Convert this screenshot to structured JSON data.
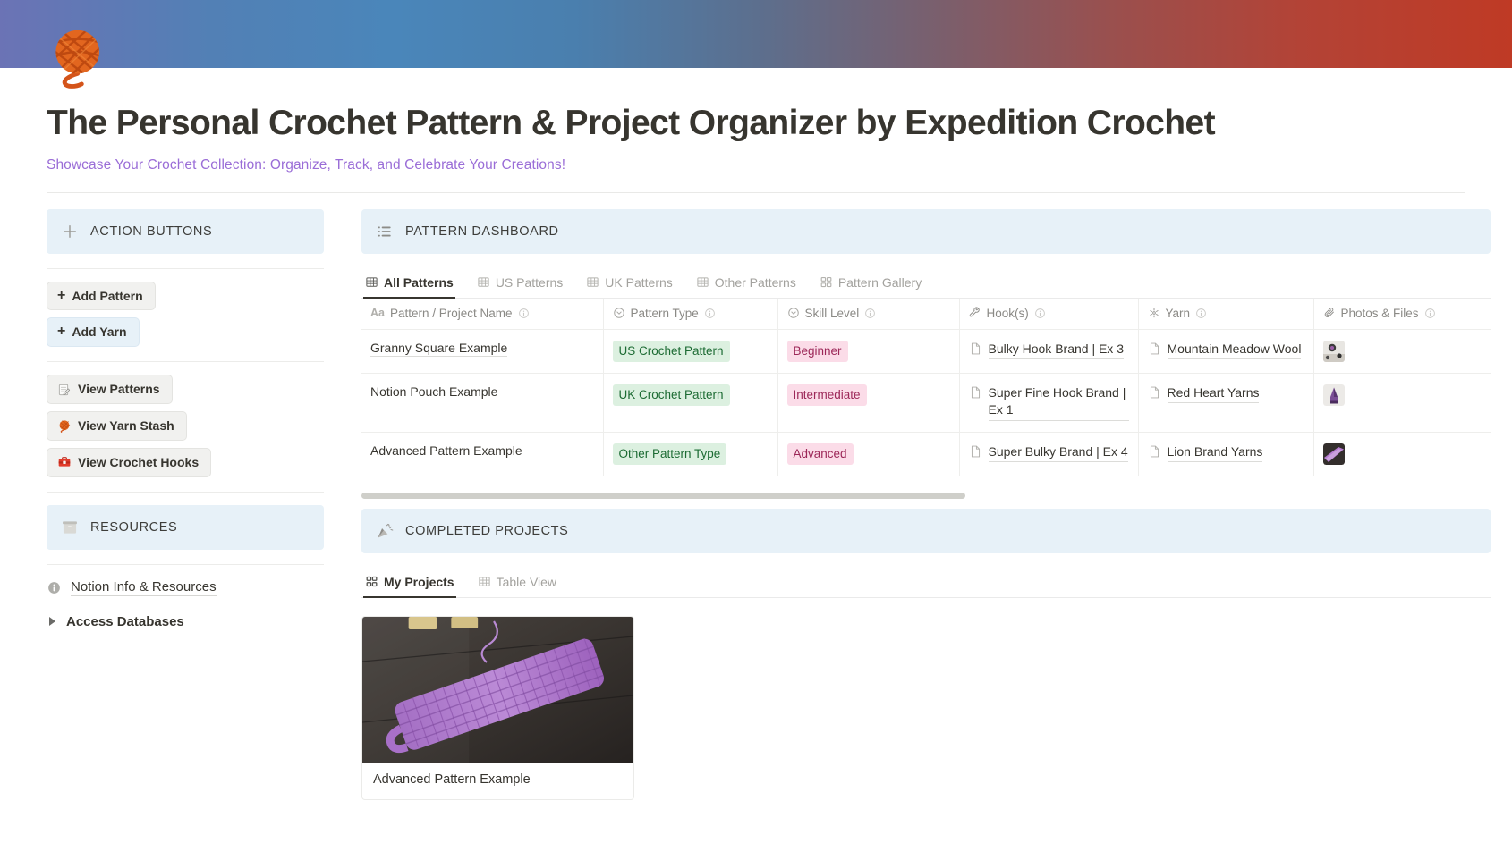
{
  "banner": {
    "icon": "yarn-ball-emoji"
  },
  "header": {
    "title": "The Personal Crochet Pattern & Project Organizer by Expedition Crochet",
    "subtitle": "Showcase Your Crochet Collection: Organize, Track, and Celebrate Your Creations!",
    "subtitle_color": "#9a6dd7"
  },
  "sidebar": {
    "action_section": {
      "label": "ACTION BUTTONS",
      "icon": "plus-icon",
      "bg": "#e7f1f8"
    },
    "buttons": [
      {
        "label": "Add Pattern",
        "icon": "plus-icon",
        "style": "grey"
      },
      {
        "label": "Add Yarn",
        "icon": "plus-icon",
        "style": "blue"
      },
      {
        "label": "View Patterns",
        "icon": "memo-icon",
        "style": "grey"
      },
      {
        "label": "View Yarn Stash",
        "icon": "yarn-ball-icon",
        "style": "grey"
      },
      {
        "label": "View Crochet Hooks",
        "icon": "toolbox-icon",
        "style": "grey"
      }
    ],
    "resources_section": {
      "label": "RESOURCES",
      "icon": "card-file-box-icon",
      "bg": "#e7f1f8"
    },
    "links": [
      {
        "label": "Notion Info & Resources",
        "icon": "info-icon"
      }
    ],
    "toggle": {
      "label": "Access Databases",
      "icon": "collapsed-triangle-icon"
    }
  },
  "pattern_dashboard": {
    "section": {
      "label": "PATTERN DASHBOARD",
      "icon": "bulleted-list-icon",
      "bg": "#e7f1f8"
    },
    "tabs": [
      {
        "label": "All Patterns",
        "icon": "table-icon",
        "active": true
      },
      {
        "label": "US Patterns",
        "icon": "table-icon",
        "active": false
      },
      {
        "label": "UK Patterns",
        "icon": "table-icon",
        "active": false
      },
      {
        "label": "Other Patterns",
        "icon": "table-icon",
        "active": false
      },
      {
        "label": "Pattern Gallery",
        "icon": "gallery-icon",
        "active": false
      }
    ],
    "columns": [
      {
        "label": "Pattern / Project Name",
        "icon": "title-aa-icon",
        "info": true
      },
      {
        "label": "Pattern Type",
        "icon": "select-icon",
        "info": true
      },
      {
        "label": "Skill Level",
        "icon": "select-icon",
        "info": true
      },
      {
        "label": "Hook(s)",
        "icon": "wrench-icon",
        "info": true
      },
      {
        "label": "Yarn",
        "icon": "relation-icon",
        "info": true
      },
      {
        "label": "Photos & Files",
        "icon": "paperclip-icon",
        "info": true
      }
    ],
    "rows": [
      {
        "name": "Granny Square Example",
        "pattern_type": "US Crochet Pattern",
        "skill_level": "Beginner",
        "hooks": "Bulky Hook Brand | Ex 3",
        "yarn": "Mountain Meadow Wool",
        "photo": "white-crochet-thumbnail"
      },
      {
        "name": "Notion Pouch Example",
        "pattern_type": "UK Crochet Pattern",
        "skill_level": "Intermediate",
        "hooks": "Super Fine Hook Brand | Ex 1",
        "yarn": "Red Heart Yarns",
        "photo": "purple-pouch-thumbnail"
      },
      {
        "name": "Advanced Pattern Example",
        "pattern_type": "Other Pattern Type",
        "skill_level": "Advanced",
        "hooks": "Super Bulky Brand | Ex 4",
        "yarn": "Lion Brand Yarns",
        "photo": "purple-scarf-thumbnail"
      }
    ],
    "tag_colors": {
      "pattern_type_bg": "#dcf0e0",
      "pattern_type_fg": "#1c6b33",
      "skill_bg": "#fbdce8",
      "skill_fg": "#9c2758"
    }
  },
  "completed_projects": {
    "section": {
      "label": "COMPLETED PROJECTS",
      "icon": "party-popper-icon",
      "bg": "#e7f1f8"
    },
    "tabs": [
      {
        "label": "My Projects",
        "icon": "gallery-icon",
        "active": true
      },
      {
        "label": "Table View",
        "icon": "table-icon",
        "active": false
      }
    ],
    "cards": [
      {
        "caption": "Advanced Pattern Example",
        "image": "purple-crochet-scarf-photo"
      }
    ]
  }
}
